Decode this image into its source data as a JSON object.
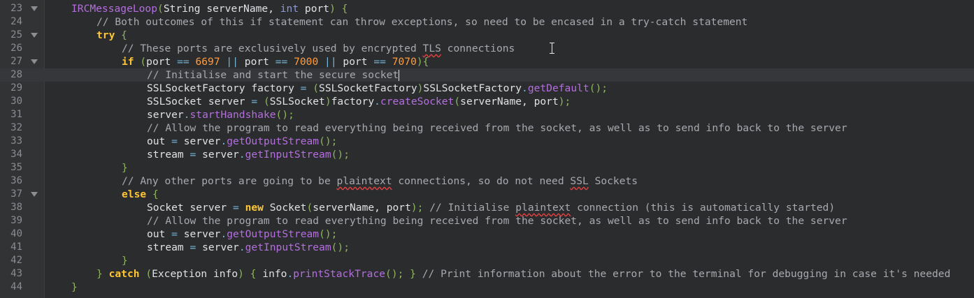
{
  "editor": {
    "current_line": 28,
    "lines": [
      {
        "n": "23",
        "fold": true,
        "indent": 1,
        "tokens": [
          [
            "IRCMessageLoop",
            "decl"
          ],
          [
            "(",
            "paren"
          ],
          [
            "String serverName",
            "plain"
          ],
          [
            ", ",
            "plain"
          ],
          [
            "int",
            "type"
          ],
          [
            " port",
            "plain"
          ],
          [
            ") {",
            "paren"
          ]
        ]
      },
      {
        "n": "24",
        "fold": false,
        "indent": 2,
        "tokens": [
          [
            "// Both outcomes of this if statement can throw exceptions, so need to be encased in a try-catch statement",
            "comment"
          ]
        ]
      },
      {
        "n": "25",
        "fold": true,
        "indent": 2,
        "tokens": [
          [
            "try",
            "kw"
          ],
          [
            " {",
            "paren"
          ]
        ]
      },
      {
        "n": "26",
        "fold": false,
        "indent": 3,
        "tokens": [
          [
            "// These ports are exclusively used by encrypted ",
            "comment"
          ],
          [
            "TLS",
            "comment squig"
          ],
          [
            " connections",
            "comment"
          ]
        ]
      },
      {
        "n": "27",
        "fold": true,
        "indent": 3,
        "tokens": [
          [
            "if",
            "kw"
          ],
          [
            " (",
            "paren"
          ],
          [
            "port ",
            "plain"
          ],
          [
            "==",
            "op"
          ],
          [
            " ",
            "plain"
          ],
          [
            "6697",
            "num"
          ],
          [
            " ",
            "plain"
          ],
          [
            "||",
            "op"
          ],
          [
            " port ",
            "plain"
          ],
          [
            "==",
            "op"
          ],
          [
            " ",
            "plain"
          ],
          [
            "7000",
            "num"
          ],
          [
            " ",
            "plain"
          ],
          [
            "||",
            "op"
          ],
          [
            " port ",
            "plain"
          ],
          [
            "==",
            "op"
          ],
          [
            " ",
            "plain"
          ],
          [
            "7070",
            "num"
          ],
          [
            "){",
            "paren"
          ]
        ]
      },
      {
        "n": "28",
        "fold": false,
        "indent": 4,
        "current": true,
        "tokens": [
          [
            "// Initialise and start the secure socket",
            "comment"
          ]
        ]
      },
      {
        "n": "29",
        "fold": false,
        "indent": 4,
        "tokens": [
          [
            "SSLSocketFactory factory ",
            "plain"
          ],
          [
            "=",
            "op"
          ],
          [
            " (",
            "paren"
          ],
          [
            "SSLSocketFactory",
            "plain"
          ],
          [
            ")",
            "paren"
          ],
          [
            "SSLSocketFactory",
            "plain"
          ],
          [
            ".",
            "op"
          ],
          [
            "getDefault",
            "fn"
          ],
          [
            "();",
            "paren"
          ]
        ]
      },
      {
        "n": "30",
        "fold": false,
        "indent": 4,
        "tokens": [
          [
            "SSLSocket server ",
            "plain"
          ],
          [
            "=",
            "op"
          ],
          [
            " (",
            "paren"
          ],
          [
            "SSLSocket",
            "plain"
          ],
          [
            ")",
            "paren"
          ],
          [
            "factory",
            "plain"
          ],
          [
            ".",
            "op"
          ],
          [
            "createSocket",
            "fn"
          ],
          [
            "(",
            "paren"
          ],
          [
            "serverName, port",
            "plain"
          ],
          [
            ");",
            "paren"
          ]
        ]
      },
      {
        "n": "31",
        "fold": false,
        "indent": 4,
        "tokens": [
          [
            "server",
            "plain"
          ],
          [
            ".",
            "op"
          ],
          [
            "startHandshake",
            "fn"
          ],
          [
            "();",
            "paren"
          ]
        ]
      },
      {
        "n": "32",
        "fold": false,
        "indent": 4,
        "tokens": [
          [
            "// Allow the program to read everything being received from the socket, as well as to send info back to the server",
            "comment"
          ]
        ]
      },
      {
        "n": "33",
        "fold": false,
        "indent": 4,
        "tokens": [
          [
            "out ",
            "plain"
          ],
          [
            "=",
            "op"
          ],
          [
            " server",
            "plain"
          ],
          [
            ".",
            "op"
          ],
          [
            "getOutputStream",
            "fn"
          ],
          [
            "();",
            "paren"
          ]
        ]
      },
      {
        "n": "34",
        "fold": false,
        "indent": 4,
        "tokens": [
          [
            "stream ",
            "plain"
          ],
          [
            "=",
            "op"
          ],
          [
            " server",
            "plain"
          ],
          [
            ".",
            "op"
          ],
          [
            "getInputStream",
            "fn"
          ],
          [
            "();",
            "paren"
          ]
        ]
      },
      {
        "n": "35",
        "fold": false,
        "indent": 3,
        "tokens": [
          [
            "}",
            "paren"
          ]
        ]
      },
      {
        "n": "36",
        "fold": false,
        "indent": 3,
        "tokens": [
          [
            "// Any other ports are going to be ",
            "comment"
          ],
          [
            "plaintext",
            "comment squig"
          ],
          [
            " connections, so do not need ",
            "comment"
          ],
          [
            "SSL",
            "comment squig"
          ],
          [
            " Sockets",
            "comment"
          ]
        ]
      },
      {
        "n": "37",
        "fold": true,
        "indent": 3,
        "tokens": [
          [
            "else",
            "kw"
          ],
          [
            " {",
            "paren"
          ]
        ]
      },
      {
        "n": "38",
        "fold": false,
        "indent": 4,
        "tokens": [
          [
            "Socket server ",
            "plain"
          ],
          [
            "=",
            "op"
          ],
          [
            " ",
            "plain"
          ],
          [
            "new",
            "kw"
          ],
          [
            " Socket",
            "plain"
          ],
          [
            "(",
            "paren"
          ],
          [
            "serverName, port",
            "plain"
          ],
          [
            ");",
            "paren"
          ],
          [
            " // Initialise ",
            "comment"
          ],
          [
            "plaintext",
            "comment squig"
          ],
          [
            " connection (this is automatically started)",
            "comment"
          ]
        ]
      },
      {
        "n": "39",
        "fold": false,
        "indent": 4,
        "tokens": [
          [
            "// Allow the program to read everything being received from the socket, as well as to send info back to the server",
            "comment"
          ]
        ]
      },
      {
        "n": "40",
        "fold": false,
        "indent": 4,
        "tokens": [
          [
            "out ",
            "plain"
          ],
          [
            "=",
            "op"
          ],
          [
            " server",
            "plain"
          ],
          [
            ".",
            "op"
          ],
          [
            "getOutputStream",
            "fn"
          ],
          [
            "();",
            "paren"
          ]
        ]
      },
      {
        "n": "41",
        "fold": false,
        "indent": 4,
        "tokens": [
          [
            "stream ",
            "plain"
          ],
          [
            "=",
            "op"
          ],
          [
            " server",
            "plain"
          ],
          [
            ".",
            "op"
          ],
          [
            "getInputStream",
            "fn"
          ],
          [
            "();",
            "paren"
          ]
        ]
      },
      {
        "n": "42",
        "fold": false,
        "indent": 3,
        "tokens": [
          [
            "}",
            "paren"
          ]
        ]
      },
      {
        "n": "43",
        "fold": false,
        "indent": 2,
        "tokens": [
          [
            "}",
            "paren"
          ],
          [
            " ",
            "plain"
          ],
          [
            "catch",
            "kw"
          ],
          [
            " (",
            "paren"
          ],
          [
            "Exception info",
            "plain"
          ],
          [
            ") { ",
            "paren"
          ],
          [
            "info",
            "plain"
          ],
          [
            ".",
            "op"
          ],
          [
            "printStackTrace",
            "fn"
          ],
          [
            "(); }",
            "paren"
          ],
          [
            " // Print information about the error to the terminal for debugging in case it's needed",
            "comment"
          ]
        ]
      },
      {
        "n": "44",
        "fold": false,
        "indent": 1,
        "tokens": [
          [
            "}",
            "paren"
          ]
        ]
      }
    ]
  },
  "colors": {
    "background": "#2b2c2e",
    "gutter": "#313335",
    "keyword": "#ffc533",
    "comment": "#a6aab0",
    "number": "#ff9d3d",
    "method": "#b56ee0",
    "type": "#8d9ad6"
  },
  "icons": {
    "fold": "fold-arrow-icon",
    "cursor": "text-cursor-icon"
  }
}
